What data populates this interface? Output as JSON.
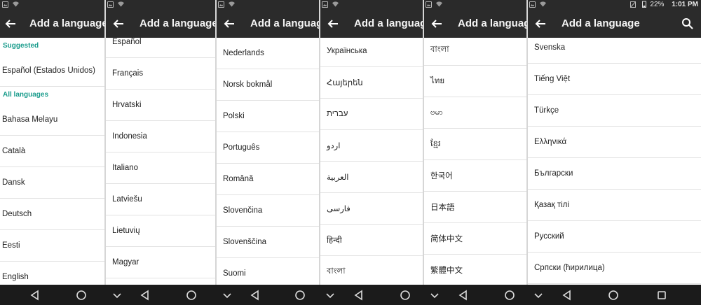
{
  "app": {
    "screen_title": "Add a language"
  },
  "status": {
    "battery": "22%",
    "time": "1:01 PM"
  },
  "panel1": {
    "suggested_header": "Suggested",
    "suggested_item": "Español (Estados Unidos)",
    "all_header": "All languages",
    "items": [
      "Bahasa Melayu",
      "Català",
      "Dansk",
      "Deutsch",
      "Eesti",
      "English"
    ]
  },
  "panel2": {
    "items": [
      "Español",
      "Français",
      "Hrvatski",
      "Indonesia",
      "Italiano",
      "Latviešu",
      "Lietuvių",
      "Magyar"
    ]
  },
  "panel3": {
    "items": [
      "Nederlands",
      "Norsk bokmål",
      "Polski",
      "Português",
      "Română",
      "Slovenčina",
      "Slovenščina",
      "Suomi"
    ]
  },
  "panel4": {
    "items": [
      "Українська",
      "Հայերեն",
      "עברית",
      "اردو",
      "العربية",
      "فارسی",
      "हिन्दी",
      "বাংলা"
    ]
  },
  "panel5": {
    "items": [
      "বাংলা",
      "ไทย",
      "ဗမာ",
      "ខ្មែរ",
      "한국어",
      "日本語",
      "简体中文",
      "繁體中文"
    ]
  },
  "panel6": {
    "items": [
      "Svenska",
      "Tiếng Việt",
      "Türkçe",
      "Ελληνικά",
      "Български",
      "Қазақ тілі",
      "Русский",
      "Српски (ћирилица)"
    ]
  },
  "icons": {
    "back": "arrow-left-icon",
    "search": "search-icon",
    "nav_back": "triangle-back-icon",
    "nav_home": "circle-home-icon",
    "nav_recents": "square-recents-icon",
    "nav_hide": "chevron-down-icon"
  },
  "colors": {
    "toolbar": "#2b2b2b",
    "accent": "#1a9c8c",
    "navbar": "#1b1b1b"
  }
}
